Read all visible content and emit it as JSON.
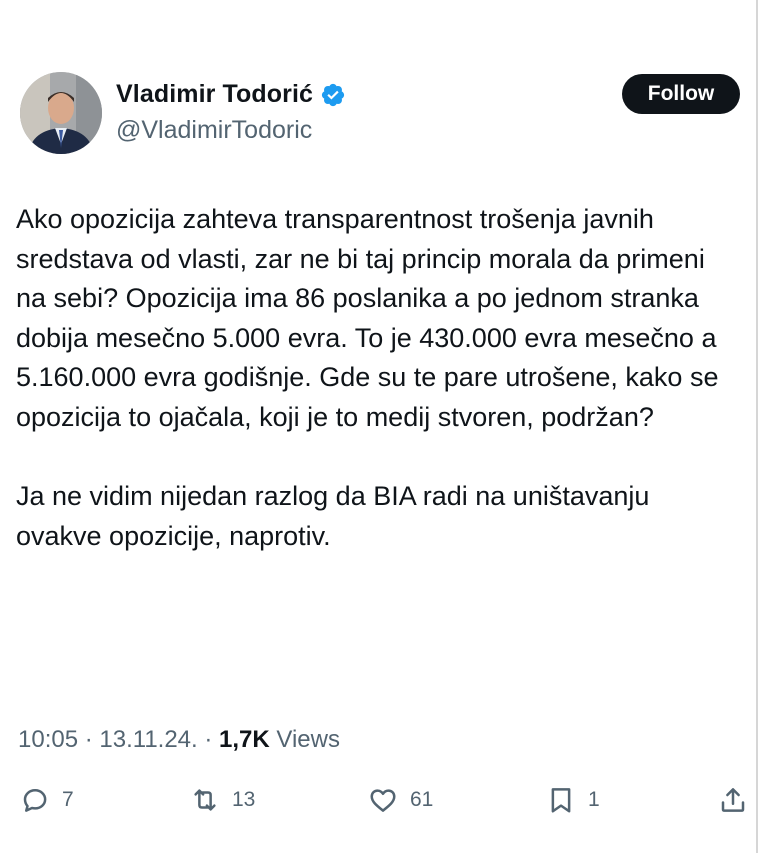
{
  "profile": {
    "display_name": "Vladimir Todorić",
    "handle": "@VladimirTodoric",
    "verified_icon": "verified-badge-icon",
    "follow_label": "Follow"
  },
  "tweet": {
    "paragraph1": "Ako opozicija zahteva transparentnost trošenja javnih sredstava od vlasti, zar ne bi taj princip morala da primeni na sebi? Opozicija ima 86 poslanika a po jednom stranka dobija mesečno 5.000 evra. To je 430.000 evra mesečno a 5.160.000 evra godišnje. Gde su te pare utrošene, kako se opozicija to ojačala, koji je to medij stvoren, podržan?",
    "paragraph2": "Ja ne vidim nijedan razlog da BIA radi na uništavanju ovakve opozicije, naprotiv."
  },
  "meta": {
    "time": "10:05",
    "separator1": " · ",
    "date": "13.11.24.",
    "separator2": " · ",
    "views_count": "1,7K",
    "views_label": " Views"
  },
  "actions": {
    "replies": "7",
    "reposts": "13",
    "likes": "61",
    "bookmarks": "1"
  },
  "colors": {
    "accent_blue": "#1d9bf0",
    "text_primary": "#0f1419",
    "text_secondary": "#536471"
  }
}
